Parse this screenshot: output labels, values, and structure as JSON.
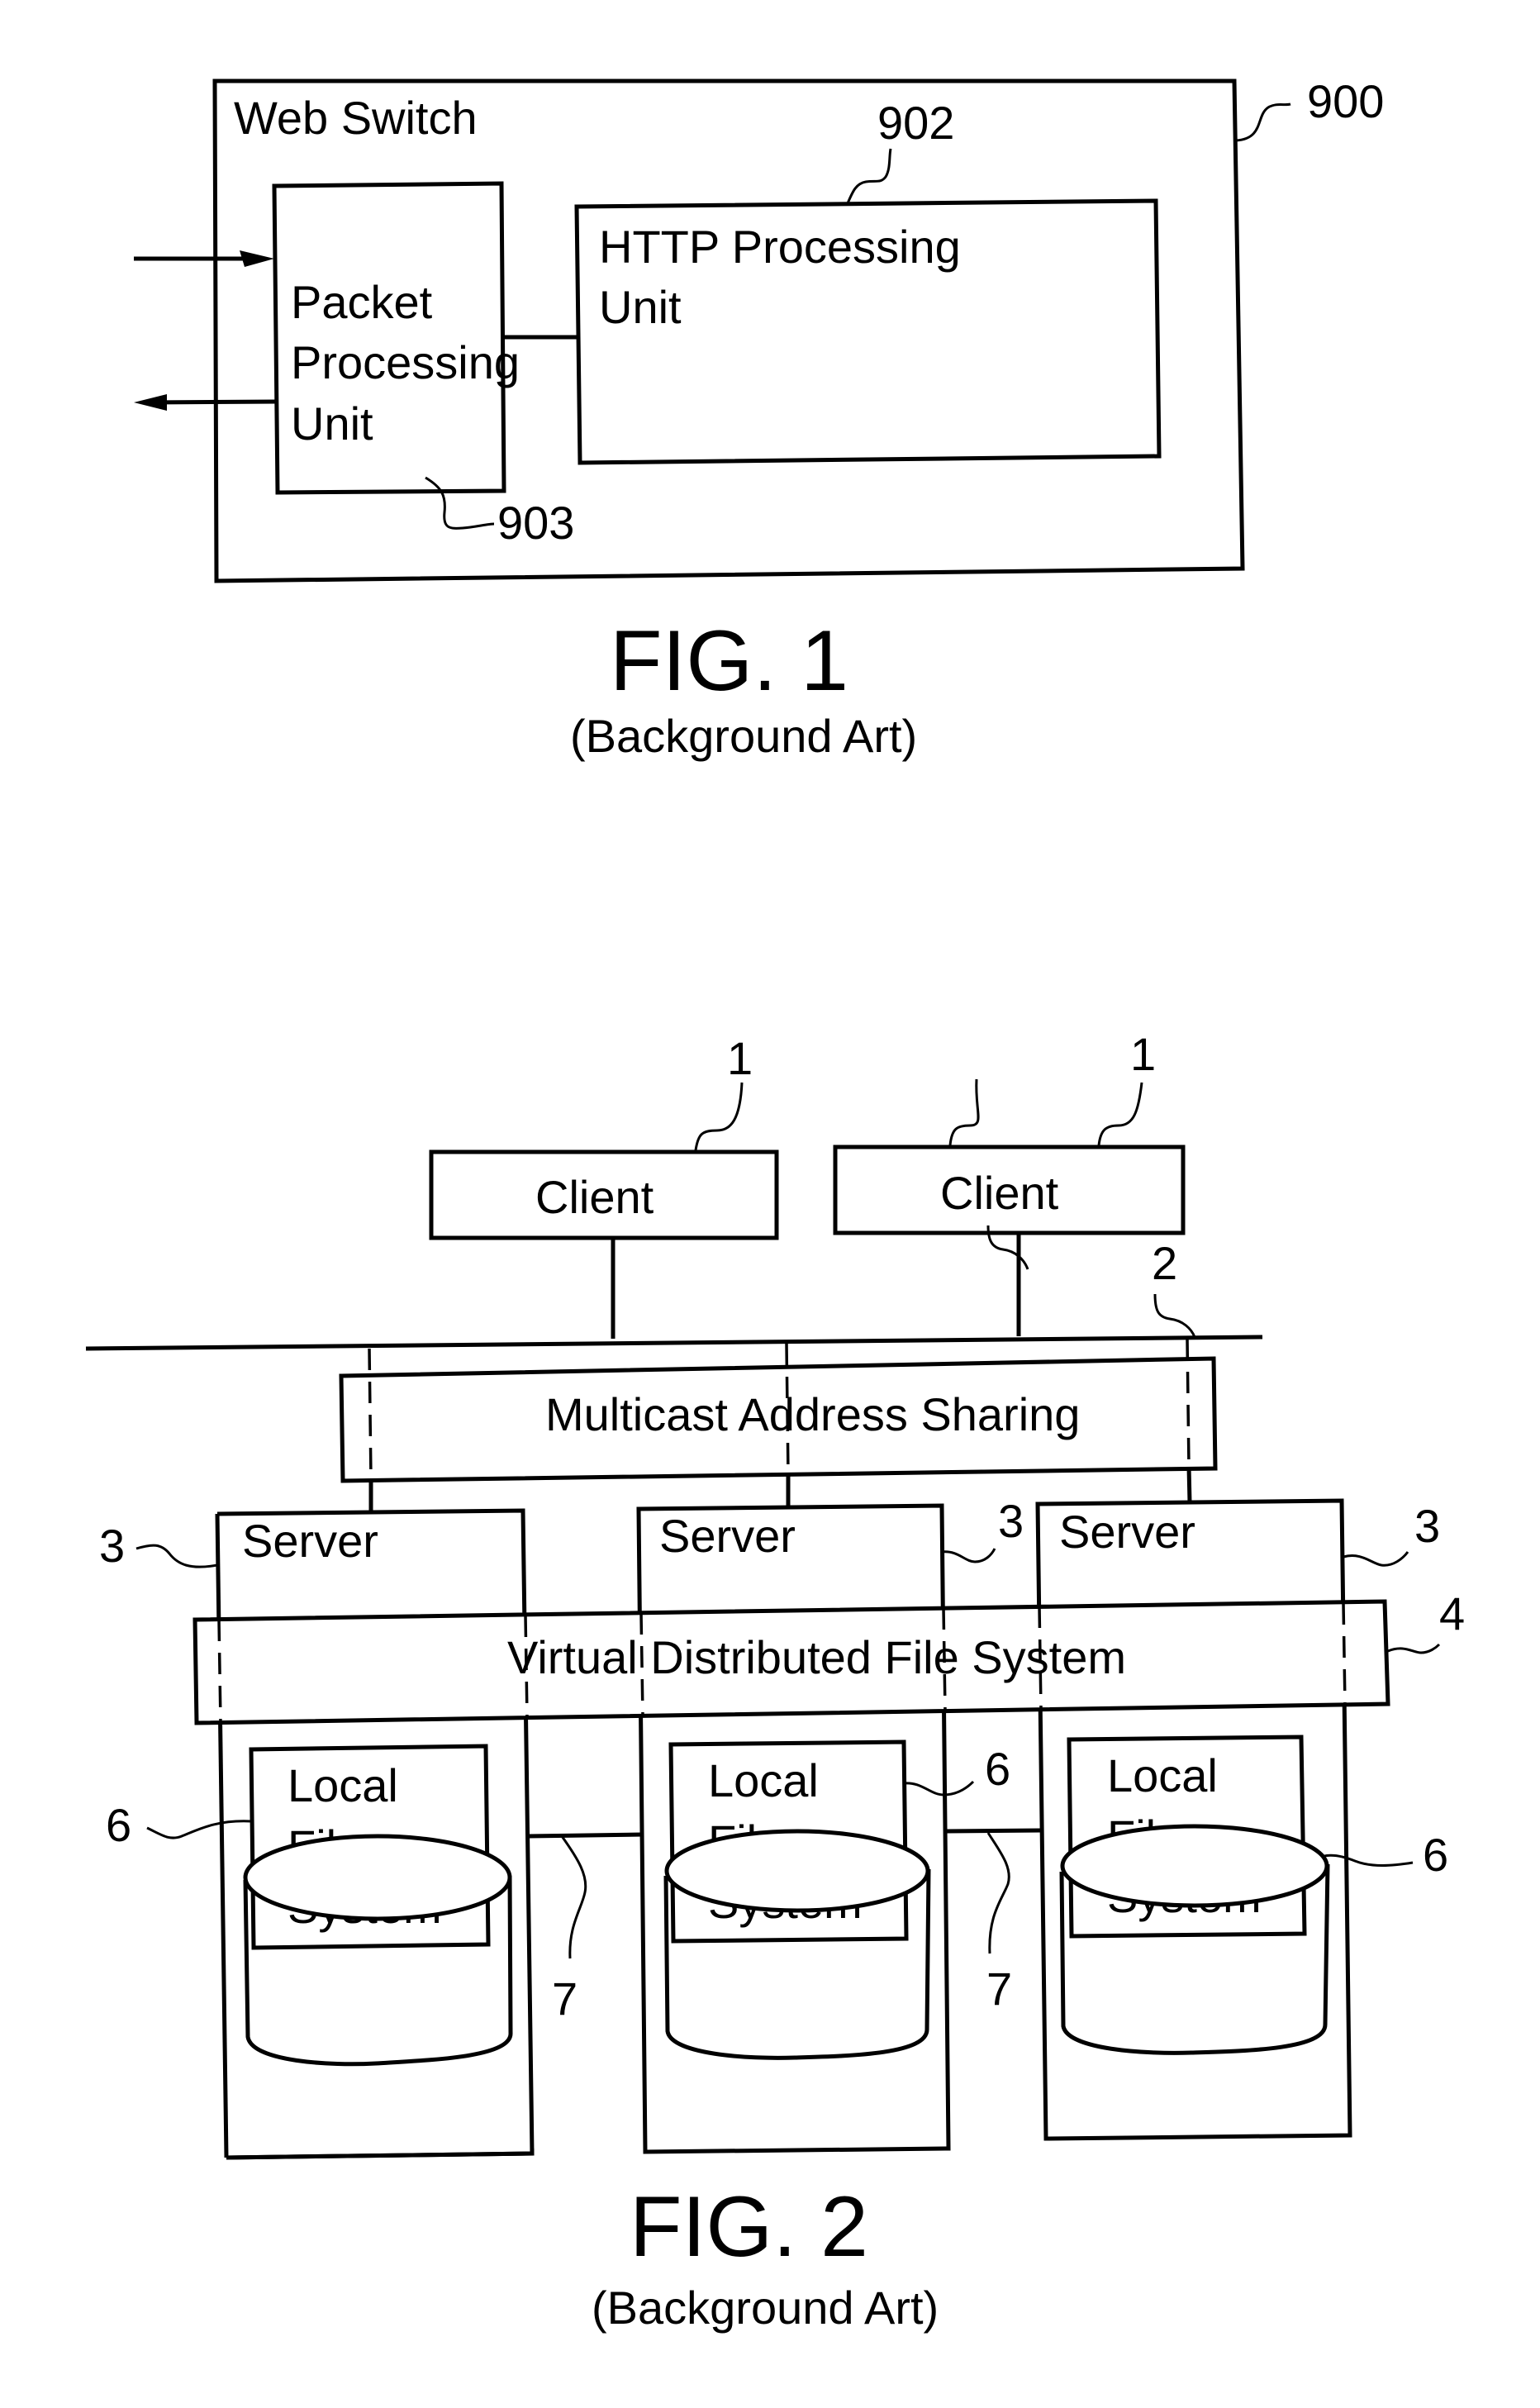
{
  "fig1": {
    "web_switch": {
      "label": "Web Switch",
      "ref": "900"
    },
    "packet_unit": {
      "lines": [
        "Packet",
        "Processing",
        "Unit"
      ],
      "ref": "903"
    },
    "http_unit": {
      "lines": [
        "HTTP Processing",
        "Unit"
      ],
      "ref": "902"
    },
    "caption": "FIG. 1",
    "subcaption": "(Background Art)"
  },
  "fig2": {
    "clients": [
      {
        "label": "Client",
        "ref": "1"
      },
      {
        "label": "Client",
        "ref": "1"
      }
    ],
    "network_ref": "2",
    "multicast": {
      "label": "Multicast Address Sharing"
    },
    "servers": [
      {
        "label": "Server",
        "ref": "3"
      },
      {
        "label": "Server",
        "ref": "3"
      },
      {
        "label": "Server",
        "ref": "3"
      }
    ],
    "vdfs": {
      "label": "Virtual Distributed File System",
      "ref": "4"
    },
    "local_fs": [
      {
        "lines": [
          "Local",
          "File",
          "System"
        ],
        "ref": "6"
      },
      {
        "lines": [
          "Local",
          "File",
          "System"
        ],
        "ref": "6"
      },
      {
        "lines": [
          "Local",
          "File",
          "System"
        ],
        "ref": "6"
      }
    ],
    "links": [
      {
        "ref": "7"
      },
      {
        "ref": "7"
      }
    ],
    "caption": "FIG. 2",
    "subcaption": "(Background Art)"
  }
}
